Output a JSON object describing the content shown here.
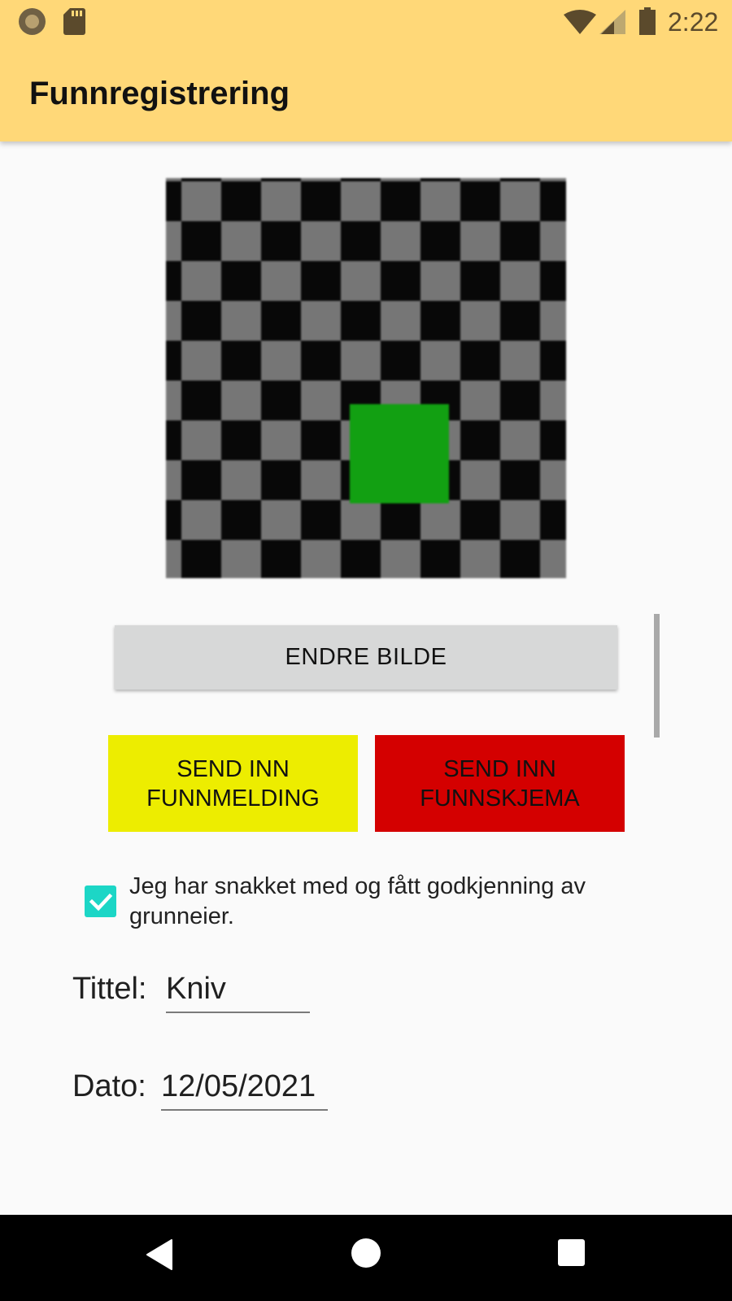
{
  "status_bar": {
    "time": "2:22",
    "icons": [
      "notification-dot-icon",
      "sd-card-icon",
      "wifi-icon",
      "signal-icon",
      "battery-icon"
    ]
  },
  "app_bar": {
    "title": "Funnregistrering",
    "color": "#ffd878"
  },
  "photo": {
    "icon": "checkerboard-image-placeholder"
  },
  "buttons": {
    "change_image": "ENDRE BILDE",
    "send_report_line1": "SEND INN",
    "send_report_line2": "FUNNMELDING",
    "send_form_line1": "SEND INN",
    "send_form_line2": "FUNNSKJEMA",
    "send_report_color": "#eded00",
    "send_form_color": "#d40000"
  },
  "consent": {
    "checked": true,
    "label": "Jeg har snakket med og fått godkjenning av grunneier."
  },
  "form": {
    "title_label": "Tittel:",
    "title_value": "Kniv",
    "date_label": "Dato:",
    "date_value": "12/05/2021"
  },
  "nav_bar": {
    "icons": [
      "back-icon",
      "home-icon",
      "recents-icon"
    ]
  }
}
